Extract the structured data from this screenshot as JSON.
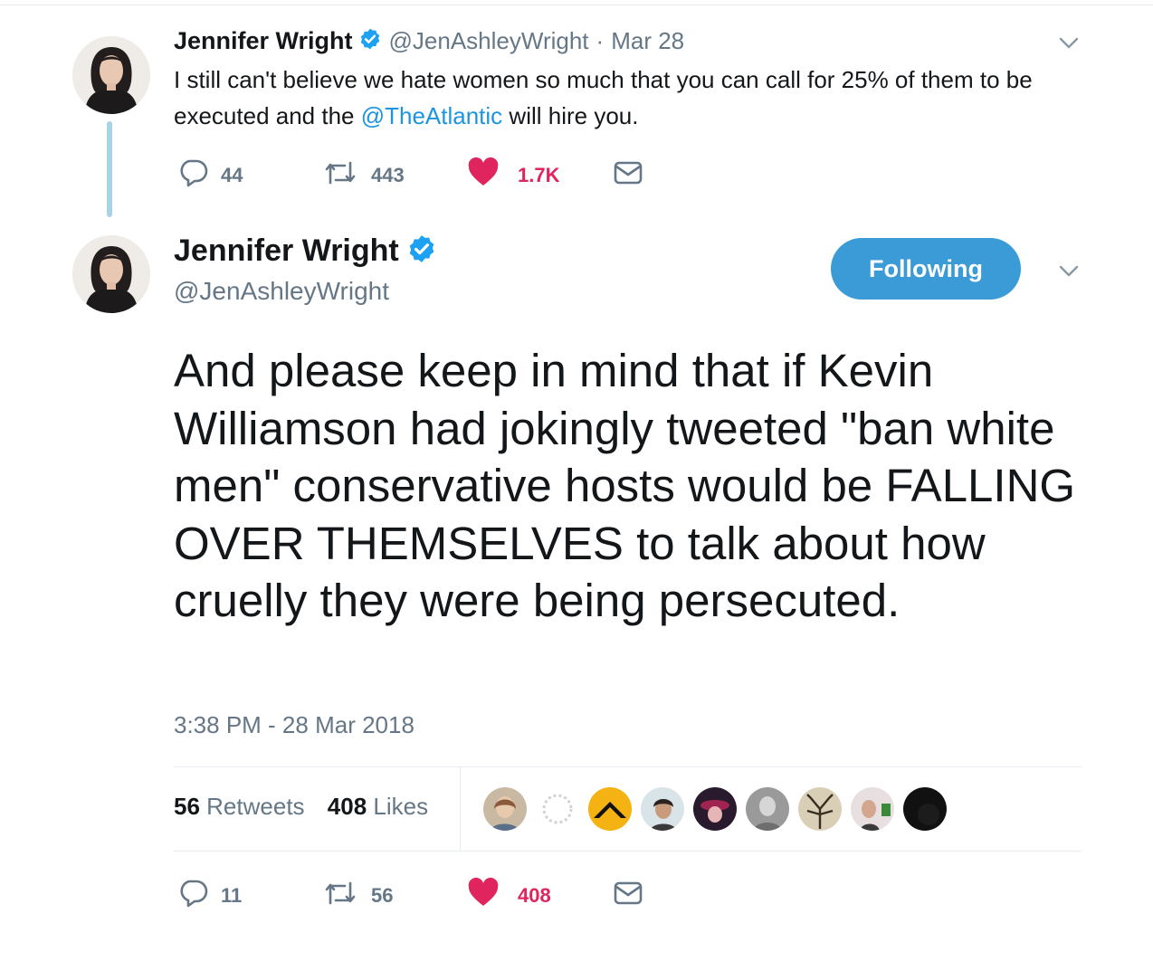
{
  "parent_tweet": {
    "author_name": "Jennifer Wright",
    "handle": "@JenAshleyWright",
    "separator": "·",
    "date": "Mar 28",
    "text_part1": "I still can't believe we hate women so much that you can call for 25% of them to be executed and the ",
    "mention": "@TheAtlantic",
    "text_part2": " will hire you.",
    "actions": {
      "replies": "44",
      "retweets": "443",
      "likes": "1.7K"
    }
  },
  "main_tweet": {
    "author_name": "Jennifer Wright",
    "handle": "@JenAshleyWright",
    "follow_button_label": "Following",
    "text": "And please keep in mind that if Kevin Williamson had jokingly tweeted \"ban white men\" conservative hosts would be FALLING OVER THEMSELVES to talk about how cruelly they were being persecuted.",
    "timestamp": "3:38 PM - 28 Mar 2018",
    "stats": {
      "retweets_count": "56",
      "retweets_label": "Retweets",
      "likes_count": "408",
      "likes_label": "Likes"
    },
    "liker_avatars": [
      "liker-1",
      "liker-2",
      "liker-3",
      "liker-4",
      "liker-5",
      "liker-6",
      "liker-7",
      "liker-8",
      "liker-9"
    ],
    "actions": {
      "replies": "11",
      "retweets": "56",
      "likes": "408"
    }
  },
  "icons": {
    "reply": "reply-icon",
    "retweet": "retweet-icon",
    "like": "heart-icon",
    "dm": "envelope-icon",
    "verified": "verified-badge-icon",
    "more": "chevron-down-icon"
  },
  "colors": {
    "text": "#14171a",
    "secondary": "#657786",
    "link": "#1b95e0",
    "like": "#e0245e",
    "follow_button": "#3a9bd6",
    "verified": "#1da1f2",
    "thread_line": "#a9d3e6"
  }
}
